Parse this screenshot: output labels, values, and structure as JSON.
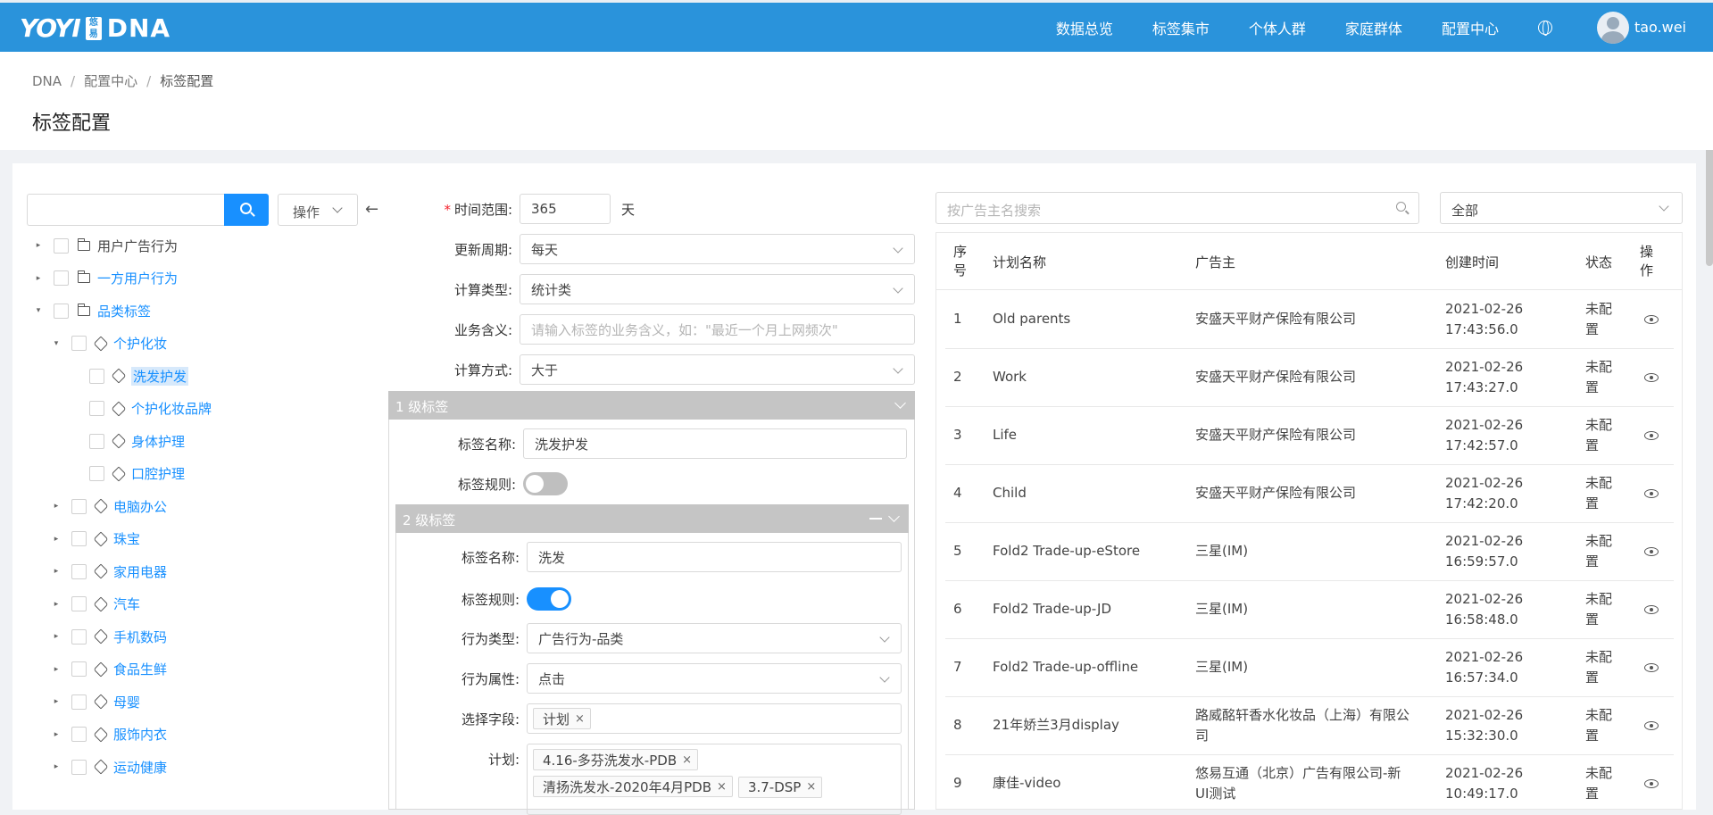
{
  "topbar": {
    "brand": "YOYI",
    "badge": "悠易",
    "product": "DNA",
    "nav": [
      "数据总览",
      "标签集市",
      "个体人群",
      "家庭群体",
      "配置中心"
    ],
    "user": "tao.wei"
  },
  "breadcrumb": [
    "DNA",
    "配置中心",
    "标签配置"
  ],
  "page_title": "标签配置",
  "left": {
    "search_value": "",
    "op_label": "操作",
    "tree": [
      {
        "label": "用户广告行为",
        "style": "dark",
        "icon": "folder-icon",
        "caret": "▸",
        "level": 0
      },
      {
        "label": "一方用户行为",
        "style": "blue",
        "icon": "folder-icon",
        "caret": "▸",
        "level": 0
      },
      {
        "label": "品类标签",
        "style": "blue",
        "icon": "folder-icon",
        "caret": "▾",
        "level": 0
      },
      {
        "label": "个护化妆",
        "style": "blue",
        "icon": "tag-icon",
        "caret": "▾",
        "level": 1
      },
      {
        "label": "洗发护发",
        "style": "sel",
        "icon": "tag-icon",
        "caret": "",
        "level": 2
      },
      {
        "label": "个护化妆品牌",
        "style": "blue",
        "icon": "tag-icon",
        "caret": "",
        "level": 2
      },
      {
        "label": "身体护理",
        "style": "blue",
        "icon": "tag-icon",
        "caret": "",
        "level": 2
      },
      {
        "label": "口腔护理",
        "style": "blue",
        "icon": "tag-icon",
        "caret": "",
        "level": 2
      },
      {
        "label": "电脑办公",
        "style": "blue",
        "icon": "tag-icon",
        "caret": "▸",
        "level": 1
      },
      {
        "label": "珠宝",
        "style": "blue",
        "icon": "tag-icon",
        "caret": "▸",
        "level": 1
      },
      {
        "label": "家用电器",
        "style": "blue",
        "icon": "tag-icon",
        "caret": "▸",
        "level": 1
      },
      {
        "label": "汽车",
        "style": "blue",
        "icon": "tag-icon",
        "caret": "▸",
        "level": 1
      },
      {
        "label": "手机数码",
        "style": "blue",
        "icon": "tag-icon",
        "caret": "▸",
        "level": 1
      },
      {
        "label": "食品生鲜",
        "style": "blue",
        "icon": "tag-icon",
        "caret": "▸",
        "level": 1
      },
      {
        "label": "母婴",
        "style": "blue",
        "icon": "tag-icon",
        "caret": "▸",
        "level": 1
      },
      {
        "label": "服饰内衣",
        "style": "blue",
        "icon": "tag-icon",
        "caret": "▸",
        "level": 1
      },
      {
        "label": "运动健康",
        "style": "blue",
        "icon": "tag-icon",
        "caret": "▸",
        "level": 1
      }
    ]
  },
  "form": {
    "time_range_label": "时间范围:",
    "time_range_value": "365",
    "time_range_unit": "天",
    "update_cycle_label": "更新周期:",
    "update_cycle_value": "每天",
    "calc_type_label": "计算类型:",
    "calc_type_value": "统计类",
    "biz_meaning_label": "业务含义:",
    "biz_meaning_placeholder": "请输入标签的业务含义，如：\"最近一个月上网频次\"",
    "calc_method_label": "计算方式:",
    "calc_method_value": "大于",
    "level1": {
      "header": "1 级标签",
      "name_label": "标签名称:",
      "name_value": "洗发护发",
      "rule_label": "标签规则:"
    },
    "level2": {
      "header": "2 级标签",
      "name_label": "标签名称:",
      "name_value": "洗发",
      "rule_label": "标签规则:",
      "behavior_type_label": "行为类型:",
      "behavior_type_value": "广告行为-品类",
      "behavior_attr_label": "行为属性:",
      "behavior_attr_value": "点击",
      "field_label": "选择字段:",
      "field_chips": [
        "计划"
      ],
      "plan_label": "计划:",
      "plan_chips": [
        "4.16-多芬洗发水-PDB",
        "清扬洗发水-2020年4月PDB",
        "3.7-DSP"
      ]
    }
  },
  "right": {
    "search_placeholder": "按广告主名搜索",
    "filter_value": "全部",
    "columns": [
      "序号",
      "计划名称",
      "广告主",
      "创建时间",
      "状态",
      "操作"
    ],
    "rows": [
      {
        "no": "1",
        "name": "Old parents",
        "advertiser": "安盛天平财产保险有限公司",
        "date": "2021-02-26",
        "time": "17:43:56.0",
        "status": "未配置"
      },
      {
        "no": "2",
        "name": "Work",
        "advertiser": "安盛天平财产保险有限公司",
        "date": "2021-02-26",
        "time": "17:43:27.0",
        "status": "未配置"
      },
      {
        "no": "3",
        "name": "Life",
        "advertiser": "安盛天平财产保险有限公司",
        "date": "2021-02-26",
        "time": "17:42:57.0",
        "status": "未配置"
      },
      {
        "no": "4",
        "name": "Child",
        "advertiser": "安盛天平财产保险有限公司",
        "date": "2021-02-26",
        "time": "17:42:20.0",
        "status": "未配置"
      },
      {
        "no": "5",
        "name": "Fold2 Trade-up-eStore",
        "advertiser": "三星(IM)",
        "date": "2021-02-26",
        "time": "16:59:57.0",
        "status": "未配置"
      },
      {
        "no": "6",
        "name": "Fold2 Trade-up-JD",
        "advertiser": "三星(IM)",
        "date": "2021-02-26",
        "time": "16:58:48.0",
        "status": "未配置"
      },
      {
        "no": "7",
        "name": "Fold2 Trade-up-offline",
        "advertiser": "三星(IM)",
        "date": "2021-02-26",
        "time": "16:57:34.0",
        "status": "未配置"
      },
      {
        "no": "8",
        "name": "21年娇兰3月display",
        "advertiser": "路威酩轩香水化妆品（上海）有限公司",
        "date": "2021-02-26",
        "time": "15:32:30.0",
        "status": "未配置"
      },
      {
        "no": "9",
        "name": "康佳-video",
        "advertiser": "悠易互通（北京）广告有限公司-新UI测试",
        "date": "2021-02-26",
        "time": "10:49:17.0",
        "status": "未配置"
      }
    ]
  },
  "colors": {
    "primary": "#2a93db",
    "accent": "#1890ff"
  }
}
